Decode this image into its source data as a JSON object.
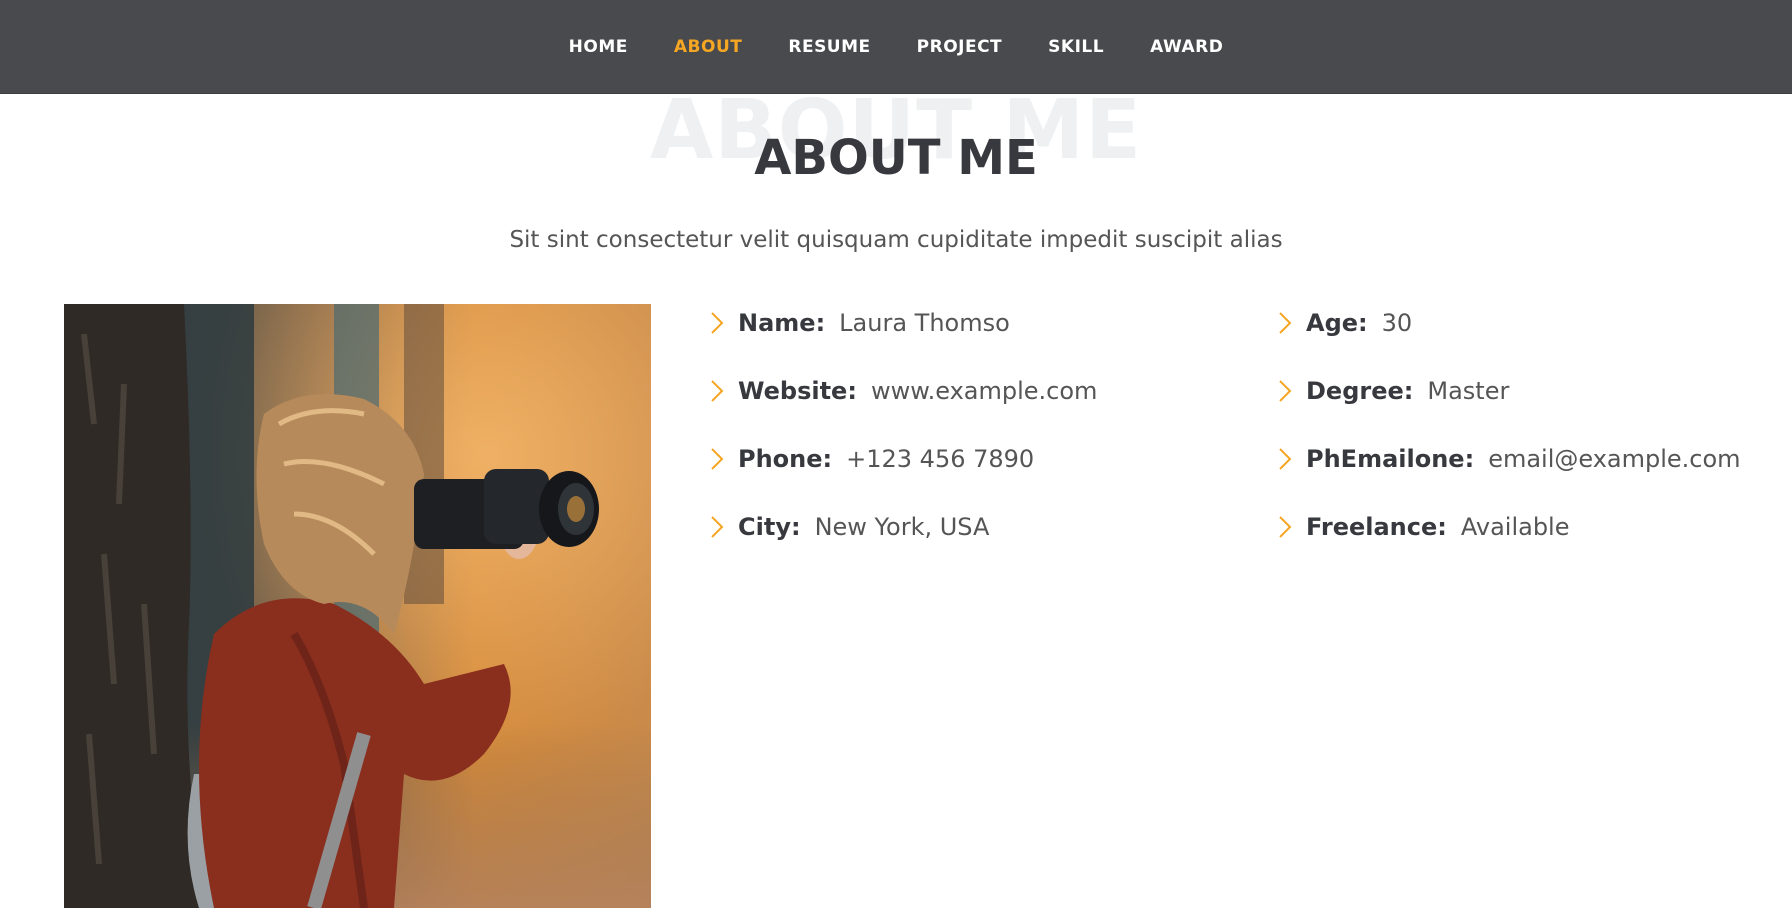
{
  "nav": {
    "items": [
      {
        "label": "HOME",
        "active": false
      },
      {
        "label": "ABOUT",
        "active": true
      },
      {
        "label": "RESUME",
        "active": false
      },
      {
        "label": "PROJECT",
        "active": false
      },
      {
        "label": "SKILL",
        "active": false
      },
      {
        "label": "AWARD",
        "active": false
      }
    ],
    "active_color": "#f5a623",
    "background": "#494a4d"
  },
  "section": {
    "bg_title": "ABOUT ME",
    "title": "ABOUT ME",
    "subtitle": "Sit sint consectetur velit quisquam cupiditate impedit suscipit alias"
  },
  "photo": {
    "icon": "photographer-with-camera-image"
  },
  "info": {
    "left": [
      {
        "label": "Name:",
        "value": "Laura Thomso"
      },
      {
        "label": "Website:",
        "value": "www.example.com"
      },
      {
        "label": "Phone:",
        "value": "+123 456 7890"
      },
      {
        "label": "City:",
        "value": "New York, USA"
      }
    ],
    "right": [
      {
        "label": "Age:",
        "value": "30"
      },
      {
        "label": "Degree:",
        "value": "Master"
      },
      {
        "label": "PhEmailone:",
        "value": "email@example.com"
      },
      {
        "label": "Freelance:",
        "value": "Available"
      }
    ],
    "bullet_icon": "chevron-right-icon",
    "accent_color": "#f5a623"
  }
}
